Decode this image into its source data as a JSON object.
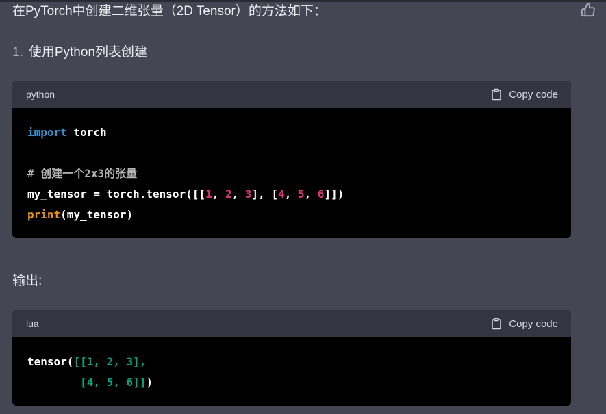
{
  "intro": "在PyTorch中创建二维张量（2D Tensor）的方法如下：",
  "step": {
    "number": "1.",
    "text": "使用Python列表创建"
  },
  "output_label": "输出:",
  "copy_label": "Copy code",
  "icons": {
    "thumbs_up": "thumbs-up-icon",
    "clipboard": "clipboard-icon"
  },
  "blocks": [
    {
      "language": "python",
      "lines": [
        [
          {
            "t": "import",
            "c": "kw"
          },
          {
            "t": " torch",
            "c": "plain"
          }
        ],
        [],
        [
          {
            "t": "# 创建一个2x3的张量",
            "c": "cm"
          }
        ],
        [
          {
            "t": "my_tensor = torch.tensor([[",
            "c": "plain"
          },
          {
            "t": "1",
            "c": "num"
          },
          {
            "t": ", ",
            "c": "plain"
          },
          {
            "t": "2",
            "c": "num"
          },
          {
            "t": ", ",
            "c": "plain"
          },
          {
            "t": "3",
            "c": "num"
          },
          {
            "t": "], [",
            "c": "plain"
          },
          {
            "t": "4",
            "c": "num"
          },
          {
            "t": ", ",
            "c": "plain"
          },
          {
            "t": "5",
            "c": "num"
          },
          {
            "t": ", ",
            "c": "plain"
          },
          {
            "t": "6",
            "c": "num"
          },
          {
            "t": "]])",
            "c": "plain"
          }
        ],
        [
          {
            "t": "print",
            "c": "bi"
          },
          {
            "t": "(my_tensor)",
            "c": "plain"
          }
        ]
      ]
    },
    {
      "language": "lua",
      "lines": [
        [
          {
            "t": "tensor(",
            "c": "plain"
          },
          {
            "t": "[[1, 2, 3],",
            "c": "teal"
          }
        ],
        [
          {
            "t": "        [4, 5, 6]]",
            "c": "teal"
          },
          {
            "t": ")",
            "c": "plain"
          }
        ]
      ]
    }
  ],
  "colors": {
    "background": "#444654",
    "code_bg": "#000000",
    "code_header": "#343541",
    "keyword": "#2e95d3",
    "number": "#df3079",
    "builtin": "#e9950c",
    "comment": "#b3b3b3",
    "string_teal": "#00a67d"
  }
}
